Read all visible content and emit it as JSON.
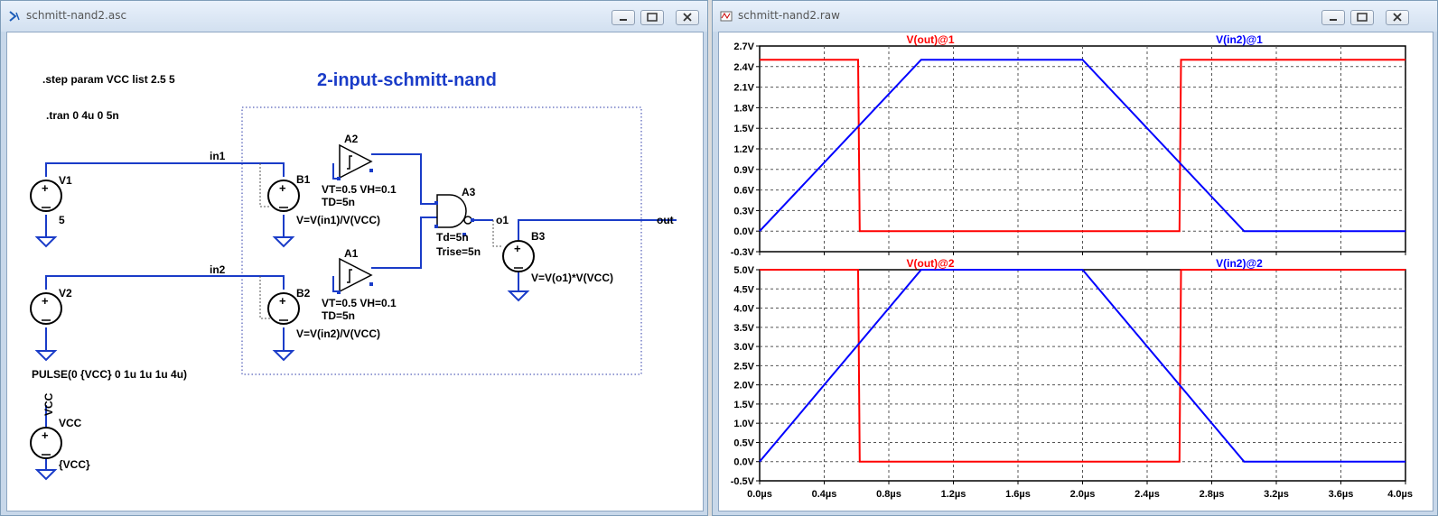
{
  "schematic_window": {
    "title": "schmitt-nand2.asc",
    "heading": "2-input-schmitt-nand",
    "directives": {
      "step": ".step param VCC list 2.5 5",
      "tran": ".tran 0 4u 0 5n"
    },
    "nets": {
      "in1": "in1",
      "in2": "in2",
      "o1": "o1",
      "out": "out",
      "vcc": "VCC"
    },
    "sources": {
      "v1": {
        "name": "V1",
        "value": "5"
      },
      "v2": {
        "name": "V2",
        "value": "PULSE(0 {VCC} 0 1u 1u 1u 4u)"
      },
      "vcc": {
        "name": "VCC",
        "value": "{VCC}"
      },
      "b1": {
        "name": "B1",
        "expr": "V=V(in1)/V(VCC)"
      },
      "b2": {
        "name": "B2",
        "expr": "V=V(in2)/V(VCC)"
      },
      "b3": {
        "name": "B3",
        "expr": "V=V(o1)*V(VCC)"
      }
    },
    "gates": {
      "a1": {
        "name": "A1",
        "params": "VT=0.5 VH=0.1",
        "td": "TD=5n"
      },
      "a2": {
        "name": "A2",
        "params": "VT=0.5 VH=0.1",
        "td": "TD=5n"
      },
      "a3": {
        "name": "A3",
        "td": "Td=5n",
        "trise": "Trise=5n"
      }
    }
  },
  "waveform_window": {
    "title": "schmitt-nand2.raw",
    "colors": {
      "out": "#ff0000",
      "in2": "#0000ff"
    },
    "x_ticks": [
      "0.0µs",
      "0.4µs",
      "0.8µs",
      "1.2µs",
      "1.6µs",
      "2.0µs",
      "2.4µs",
      "2.8µs",
      "3.2µs",
      "3.6µs",
      "4.0µs"
    ],
    "pane1_ticks": [
      "2.7V",
      "2.4V",
      "2.1V",
      "1.8V",
      "1.5V",
      "1.2V",
      "0.9V",
      "0.6V",
      "0.3V",
      "0.0V",
      "-0.3V"
    ],
    "pane2_ticks": [
      "5.0V",
      "4.5V",
      "4.0V",
      "3.5V",
      "3.0V",
      "2.5V",
      "2.0V",
      "1.5V",
      "1.0V",
      "0.5V",
      "0.0V",
      "-0.5V"
    ]
  },
  "chart_data": [
    {
      "type": "line",
      "xlabel": "",
      "ylabel": "",
      "xlim": [
        0,
        4.0
      ],
      "ylim": [
        -0.3,
        2.7
      ],
      "grid": true,
      "series": [
        {
          "name": "V(out)@1",
          "x": [
            0,
            0.61,
            0.62,
            2.6,
            2.61,
            4.0
          ],
          "values": [
            2.5,
            2.5,
            0.0,
            0.0,
            2.5,
            2.5
          ]
        },
        {
          "name": "V(in2)@1",
          "x": [
            0,
            1.0,
            2.0,
            3.0,
            4.0
          ],
          "values": [
            0.0,
            2.5,
            2.5,
            0.0,
            0.0
          ]
        }
      ]
    },
    {
      "type": "line",
      "xlabel": "",
      "ylabel": "",
      "xlim": [
        0,
        4.0
      ],
      "ylim": [
        -0.5,
        5.0
      ],
      "grid": true,
      "series": [
        {
          "name": "V(out)@2",
          "x": [
            0,
            0.61,
            0.62,
            2.6,
            2.61,
            4.0
          ],
          "values": [
            5.0,
            5.0,
            0.0,
            0.0,
            5.0,
            5.0
          ]
        },
        {
          "name": "V(in2)@2",
          "x": [
            0,
            1.0,
            2.0,
            3.0,
            4.0
          ],
          "values": [
            0.0,
            5.0,
            5.0,
            0.0,
            0.0
          ]
        }
      ]
    }
  ]
}
